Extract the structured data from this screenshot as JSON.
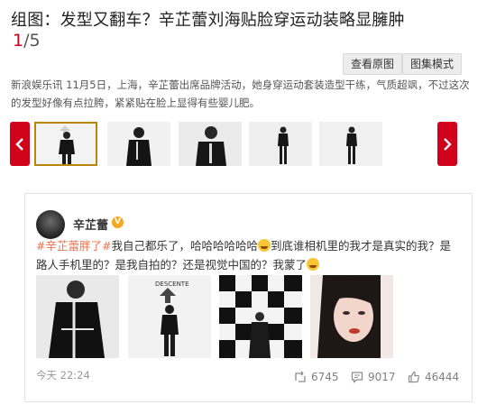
{
  "article": {
    "title": "组图：发型又翻车？辛芷蕾刘海贴脸穿运动装略显臃肿",
    "page_current": "1",
    "page_total": "/5",
    "view_original_label": "查看原图",
    "gallery_mode_label": "图集模式",
    "description": "新浪娱乐讯 11月5日，上海，辛芷蕾出席品牌活动，她身穿运动套装造型干练，气质超飒，不过这次的发型好像有点拉胯，紧紧贴在脸上显得有些婴儿肥。"
  },
  "thumbnails": {
    "prev_icon": "chevron-left-icon",
    "next_icon": "chevron-right-icon",
    "items": [
      {
        "active": true,
        "bg": "#f2f2f2"
      },
      {
        "active": false,
        "bg": "#f2f2f2"
      },
      {
        "active": false,
        "bg": "#e9e9e9"
      },
      {
        "active": false,
        "bg": "#eeeeee"
      },
      {
        "active": false,
        "bg": "#eeeeee"
      }
    ]
  },
  "weibo": {
    "username": "辛芷蕾",
    "verified_icon": "verified-v-icon",
    "hashtag": "#辛芷蕾胖了#",
    "text_1": "我自己都乐了，哈哈哈哈哈哈",
    "text_2": "到底谁相机里的我才是真实的我？是路人手机里的？是我自拍的？还是视觉中国的？我蒙了",
    "time": "今天 22:24",
    "reposts": "6745",
    "comments": "9017",
    "likes": "46444",
    "photo_brand_text": "DESCENTE"
  },
  "colors": {
    "accent_red": "#d0021b",
    "hashtag_orange": "#eb7350",
    "verified_gold": "#f5a623",
    "active_thumb_border": "#b8860b"
  }
}
